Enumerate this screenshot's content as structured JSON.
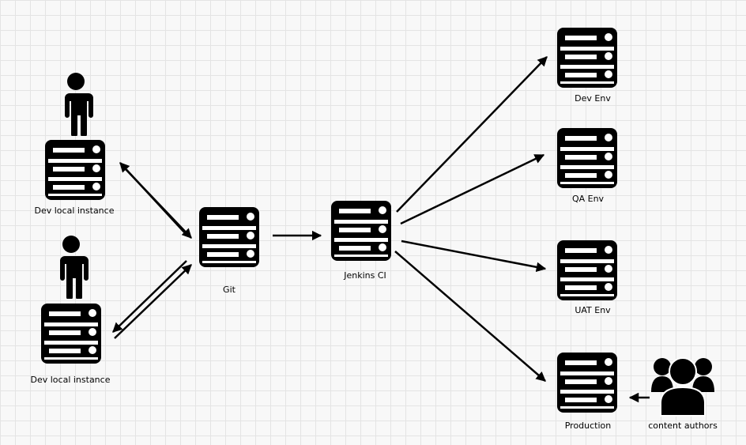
{
  "nodes": {
    "dev_local_1": {
      "label": "Dev local instance",
      "icon": "server-icon",
      "user_icon": "person-icon"
    },
    "dev_local_2": {
      "label": "Dev local instance",
      "icon": "server-icon",
      "user_icon": "person-icon"
    },
    "git": {
      "label": "Git",
      "icon": "server-icon"
    },
    "jenkins": {
      "label": "Jenkins CI",
      "icon": "server-icon"
    },
    "dev_env": {
      "label": "Dev Env",
      "icon": "server-icon"
    },
    "qa_env": {
      "label": "QA Env",
      "icon": "server-icon"
    },
    "uat_env": {
      "label": "UAT Env",
      "icon": "server-icon"
    },
    "production": {
      "label": "Production",
      "icon": "server-icon"
    },
    "content_authors": {
      "label": "content authors",
      "icon": "user-group-icon"
    }
  },
  "edges": [
    {
      "from": "git",
      "to": "dev_local_1"
    },
    {
      "from": "dev_local_1",
      "to": "git"
    },
    {
      "from": "dev_local_2",
      "to": "git"
    },
    {
      "from": "git",
      "to": "dev_local_2"
    },
    {
      "from": "git",
      "to": "jenkins"
    },
    {
      "from": "jenkins",
      "to": "dev_env"
    },
    {
      "from": "jenkins",
      "to": "qa_env"
    },
    {
      "from": "jenkins",
      "to": "uat_env"
    },
    {
      "from": "jenkins",
      "to": "production"
    },
    {
      "from": "content_authors",
      "to": "production"
    }
  ],
  "colors": {
    "stroke": "#000000",
    "background": "#f8f8f8"
  }
}
